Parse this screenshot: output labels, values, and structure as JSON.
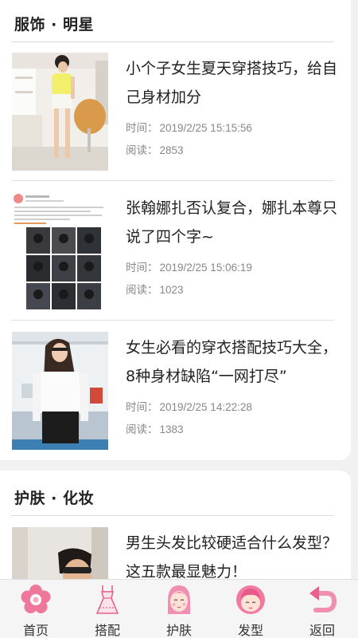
{
  "sections": [
    {
      "title": "服饰 · 明星",
      "articles": [
        {
          "title": "小个子女生夏天穿搭技巧，给自己身材加分",
          "time_label": "时间：",
          "time": "2019/2/25 15:15:56",
          "read_label": "阅读：",
          "reads": "2853"
        },
        {
          "title": "张翰娜扎否认复合，娜扎本尊只说了四个字~",
          "time_label": "时间：",
          "time": "2019/2/25 15:06:19",
          "read_label": "阅读：",
          "reads": "1023"
        },
        {
          "title": "女生必看的穿衣搭配技巧大全，8种身材缺陷“一网打尽”",
          "time_label": "时间：",
          "time": "2019/2/25 14:22:28",
          "read_label": "阅读：",
          "reads": "1383"
        }
      ]
    },
    {
      "title": "护肤 · 化妆",
      "articles": [
        {
          "title": "男生头发比较硬适合什么发型？这五款最显魅力！"
        }
      ]
    }
  ],
  "tabbar": [
    {
      "label": "首页",
      "icon": "flower-icon"
    },
    {
      "label": "搭配",
      "icon": "dress-icon"
    },
    {
      "label": "护肤",
      "icon": "girl-face-icon"
    },
    {
      "label": "发型",
      "icon": "hairstyle-icon"
    },
    {
      "label": "返回",
      "icon": "back-arrow-icon"
    }
  ],
  "colors": {
    "accent_pink": "#e8628f",
    "light_pink": "#f6b8cb",
    "text": "#222222",
    "meta_text": "#888888"
  }
}
